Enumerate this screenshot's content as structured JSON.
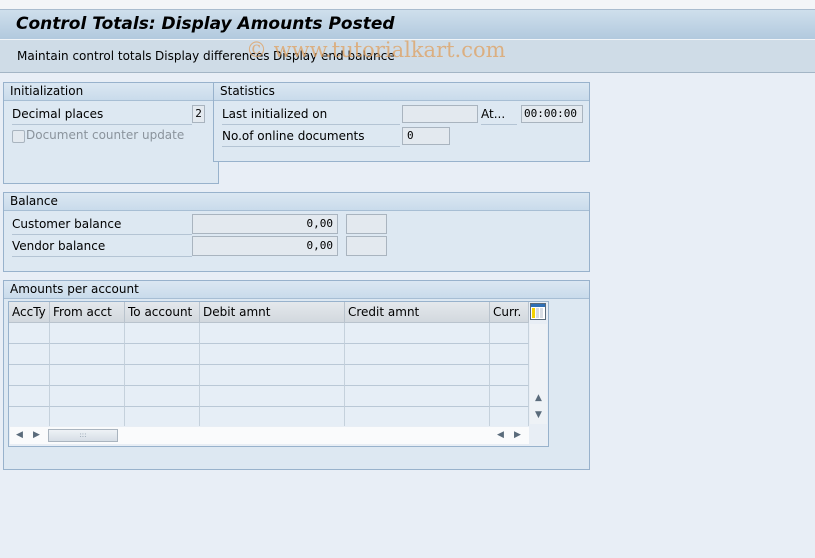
{
  "title": "Control Totals: Display Amounts Posted",
  "toolbar": {
    "maintain": "Maintain control totals",
    "differences": "Display differences",
    "end_balance": "Display end balance"
  },
  "watermark": "© www.tutorialkart.com",
  "initialization": {
    "header": "Initialization",
    "decimal_places_label": "Decimal places",
    "decimal_places_value": "2",
    "doc_counter_label": "Document counter update",
    "doc_counter_checked": false
  },
  "statistics": {
    "header": "Statistics",
    "last_init_label": "Last initialized on",
    "last_init_value": "",
    "at_label": "At...",
    "at_value": "00:00:00",
    "online_docs_label": "No.of online documents",
    "online_docs_value": "0"
  },
  "balance": {
    "header": "Balance",
    "customer_label": "Customer balance",
    "customer_value": "0,00",
    "customer_currency": "",
    "vendor_label": "Vendor balance",
    "vendor_value": "0,00",
    "vendor_currency": ""
  },
  "amounts": {
    "header": "Amounts per account",
    "columns": [
      "AccTy",
      "From acct",
      "To account",
      "Debit amnt",
      "Credit amnt",
      "Curr."
    ],
    "rows": [
      [
        "",
        "",
        "",
        "",
        "",
        ""
      ],
      [
        "",
        "",
        "",
        "",
        "",
        ""
      ],
      [
        "",
        "",
        "",
        "",
        "",
        ""
      ],
      [
        "",
        "",
        "",
        "",
        "",
        ""
      ],
      [
        "",
        "",
        "",
        "",
        "",
        ""
      ]
    ]
  },
  "icons": {
    "column_config": "column-settings-icon",
    "scroll_up": "▲",
    "scroll_down": "▼",
    "scroll_left": "◀",
    "scroll_right": "▶",
    "thumb_grip": ":::"
  }
}
